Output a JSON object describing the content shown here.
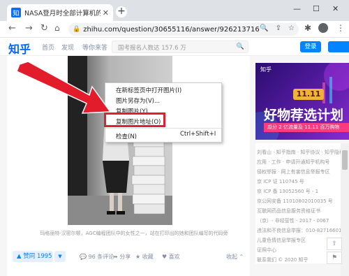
{
  "browser": {
    "tab_title": "NASA登月时全部计算机的计算能",
    "tab_favicon": "知",
    "tab_close": "✕",
    "new_tab": "+",
    "url": "zhihu.com/question/30655116/answer/926213716",
    "window_controls": [
      "—",
      "☐",
      "✕"
    ]
  },
  "zhihu": {
    "logo": "知乎",
    "nav": [
      "首页",
      "发现",
      "等你来答"
    ],
    "search_placeholder": "国考报名人数达 157.6 万",
    "login": "登录"
  },
  "content": {
    "caption": "玛格丽特·汉密尔顿，AGC编程团队中的女性之一，站在打印出的她和团队编写的代码旁"
  },
  "context_menu": {
    "items": [
      "在新标签页中打开图片(I)",
      "图片另存为(V)...",
      "复制图片(Y)",
      "复制图片地址(O)",
      "检查(N)"
    ],
    "shortcut": "Ctrl+Shift+I"
  },
  "actions": {
    "vote": "▲ 赞同 1995",
    "vote_down": "▼",
    "comments": "💬 96 条评论",
    "share": "➦ 分享",
    "favorite": "★ 收藏",
    "like": "♥ 喜欢",
    "collapse": "收起 ⌃"
  },
  "banner": {
    "brand": "知乎",
    "tag": "11.11",
    "headline": "好物荐选计划",
    "sub": "瓜分 2 亿流量及 11.11 百万购物"
  },
  "sidebar": {
    "lines": [
      "刘看山 · 知乎指南 · 知乎协议 · 知乎隐私",
      "应用 · 工作 · 申请开通知乎机构号",
      "侵权举报 · 网上有害信息举报专区",
      "京 ICP 证 110745 号",
      "京 ICP 备 13052560 号 - 1",
      "京公网安备 11010802010035 号",
      "互联网药品信息服务资格证书",
      "（京）- 非经营性 - 2017 - 0067",
      "违法和不良信息举报：010-82716601",
      "儿童色情信息举报专区",
      "证照中心",
      "联系我们 © 2020 知乎"
    ]
  },
  "colors": {
    "zhihu_blue": "#0084ff",
    "highlight_red": "#e0202e"
  }
}
